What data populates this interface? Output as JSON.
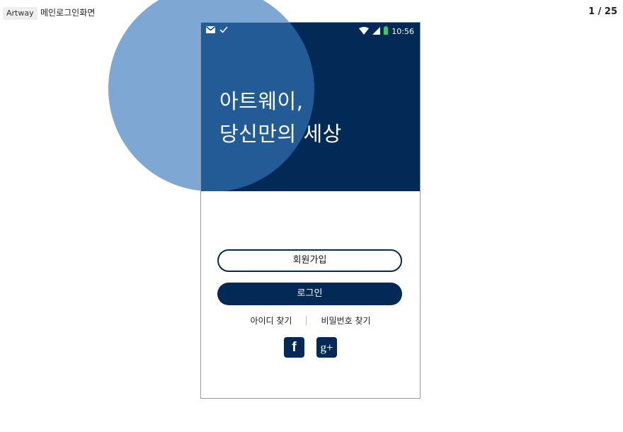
{
  "header": {
    "tag": "Artway",
    "title": "메인로그인화면",
    "page_counter": "1 / 25"
  },
  "statusbar": {
    "time": "10:56",
    "icons": [
      "mail-icon",
      "check-icon",
      "wifi-icon",
      "signal-icon",
      "battery-icon"
    ],
    "battery_color": "#2bd35a"
  },
  "hero": {
    "line1": "아트웨이,",
    "line2": "당신만의 세상"
  },
  "buttons": {
    "signup": "회원가입",
    "login": "로그인"
  },
  "links": {
    "find_id": "아이디 찾기",
    "find_password": "비밀번호 찾기"
  },
  "social": {
    "facebook_label": "f",
    "google_label": "g+"
  },
  "colors": {
    "primary": "#032a56",
    "hero_circle": "#225b95",
    "deco_circle": "#7ea7d3"
  }
}
